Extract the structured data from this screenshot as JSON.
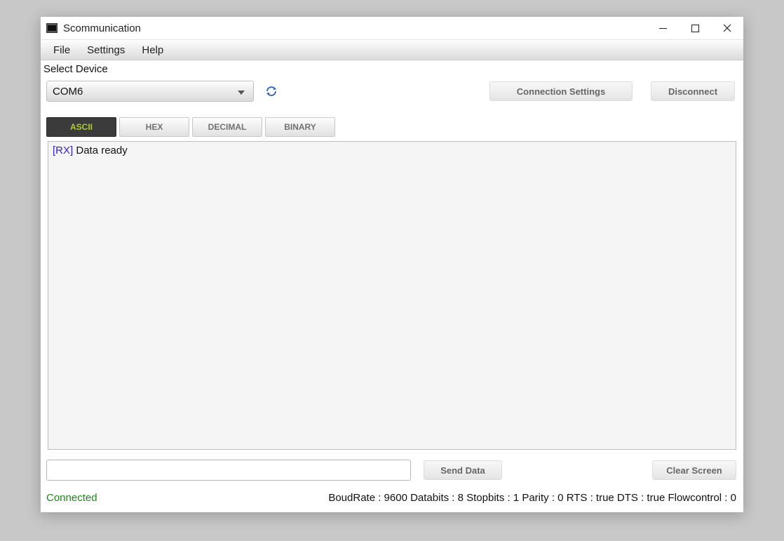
{
  "window": {
    "title": "Scommunication"
  },
  "menu": {
    "file": "File",
    "settings": "Settings",
    "help": "Help"
  },
  "device": {
    "label": "Select Device",
    "selected": "COM6"
  },
  "buttons": {
    "connection_settings": "Connection Settings",
    "disconnect": "Disconnect",
    "send_data": "Send Data",
    "clear_screen": "Clear Screen"
  },
  "tabs": {
    "ascii": "ASCII",
    "hex": "HEX",
    "decimal": "DECIMAL",
    "binary": "BINARY"
  },
  "terminal": {
    "rx_tag": "[RX]",
    "line1": " Data ready"
  },
  "input": {
    "value": ""
  },
  "status": {
    "connected": "Connected",
    "info": "BoudRate : 9600 Databits : 8 Stopbits : 1 Parity : 0 RTS : true DTS : true Flowcontrol : 0"
  }
}
